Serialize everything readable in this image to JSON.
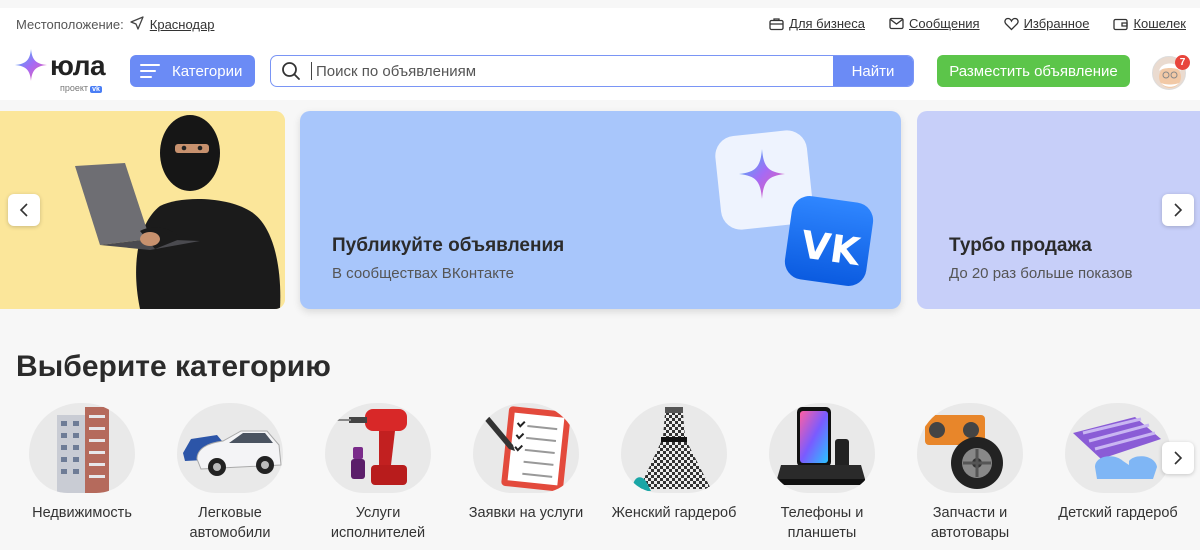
{
  "location": {
    "label": "Местоположение:",
    "city": "Краснодар"
  },
  "toplinks": [
    {
      "label": "Для бизнеса",
      "icon": "briefcase-icon"
    },
    {
      "label": "Сообщения",
      "icon": "envelope-icon"
    },
    {
      "label": "Избранное",
      "icon": "heart-icon"
    },
    {
      "label": "Кошелек",
      "icon": "wallet-icon"
    }
  ],
  "logo": {
    "word": "юла",
    "sub": "проект",
    "sub_badge": "vk"
  },
  "header": {
    "categories_label": "Категории",
    "search_placeholder": "Поиск по объявлениям",
    "search_value": "",
    "find_label": "Найти",
    "post_label": "Разместить объявление",
    "notif_count": "7"
  },
  "banners": [
    {
      "title": "",
      "subtitle": ""
    },
    {
      "title": "Публикуйте объявления",
      "subtitle": "В сообществах ВКонтакте"
    },
    {
      "title": "Турбо продажа",
      "subtitle": "До 20 раз больше показов"
    }
  ],
  "section_title": "Выберите категорию",
  "categories": [
    {
      "label": "Недвижимость"
    },
    {
      "label": "Легковые автомобили"
    },
    {
      "label": "Услуги исполнителей"
    },
    {
      "label": "Заявки на услуги"
    },
    {
      "label": "Женский гардероб"
    },
    {
      "label": "Телефоны и планшеты"
    },
    {
      "label": "Запчасти и автотовары"
    },
    {
      "label": "Детский гардероб"
    }
  ],
  "colors": {
    "accent": "#6b8bf5",
    "green": "#5cc54a",
    "badge": "#e8453c"
  }
}
